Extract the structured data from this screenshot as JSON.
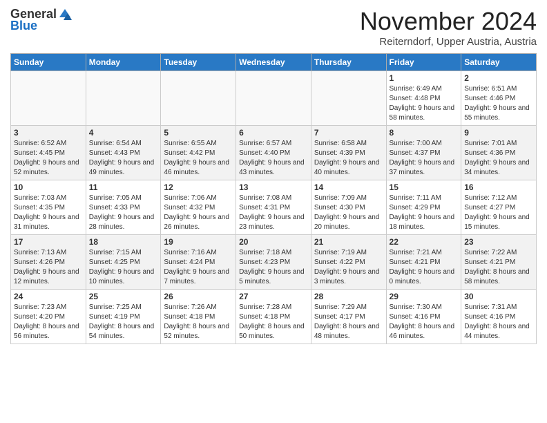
{
  "header": {
    "logo_general": "General",
    "logo_blue": "Blue",
    "month_title": "November 2024",
    "location": "Reiterndorf, Upper Austria, Austria"
  },
  "weekdays": [
    "Sunday",
    "Monday",
    "Tuesday",
    "Wednesday",
    "Thursday",
    "Friday",
    "Saturday"
  ],
  "weeks": [
    [
      {
        "day": "",
        "info": ""
      },
      {
        "day": "",
        "info": ""
      },
      {
        "day": "",
        "info": ""
      },
      {
        "day": "",
        "info": ""
      },
      {
        "day": "",
        "info": ""
      },
      {
        "day": "1",
        "info": "Sunrise: 6:49 AM\nSunset: 4:48 PM\nDaylight: 9 hours and 58 minutes."
      },
      {
        "day": "2",
        "info": "Sunrise: 6:51 AM\nSunset: 4:46 PM\nDaylight: 9 hours and 55 minutes."
      }
    ],
    [
      {
        "day": "3",
        "info": "Sunrise: 6:52 AM\nSunset: 4:45 PM\nDaylight: 9 hours and 52 minutes."
      },
      {
        "day": "4",
        "info": "Sunrise: 6:54 AM\nSunset: 4:43 PM\nDaylight: 9 hours and 49 minutes."
      },
      {
        "day": "5",
        "info": "Sunrise: 6:55 AM\nSunset: 4:42 PM\nDaylight: 9 hours and 46 minutes."
      },
      {
        "day": "6",
        "info": "Sunrise: 6:57 AM\nSunset: 4:40 PM\nDaylight: 9 hours and 43 minutes."
      },
      {
        "day": "7",
        "info": "Sunrise: 6:58 AM\nSunset: 4:39 PM\nDaylight: 9 hours and 40 minutes."
      },
      {
        "day": "8",
        "info": "Sunrise: 7:00 AM\nSunset: 4:37 PM\nDaylight: 9 hours and 37 minutes."
      },
      {
        "day": "9",
        "info": "Sunrise: 7:01 AM\nSunset: 4:36 PM\nDaylight: 9 hours and 34 minutes."
      }
    ],
    [
      {
        "day": "10",
        "info": "Sunrise: 7:03 AM\nSunset: 4:35 PM\nDaylight: 9 hours and 31 minutes."
      },
      {
        "day": "11",
        "info": "Sunrise: 7:05 AM\nSunset: 4:33 PM\nDaylight: 9 hours and 28 minutes."
      },
      {
        "day": "12",
        "info": "Sunrise: 7:06 AM\nSunset: 4:32 PM\nDaylight: 9 hours and 26 minutes."
      },
      {
        "day": "13",
        "info": "Sunrise: 7:08 AM\nSunset: 4:31 PM\nDaylight: 9 hours and 23 minutes."
      },
      {
        "day": "14",
        "info": "Sunrise: 7:09 AM\nSunset: 4:30 PM\nDaylight: 9 hours and 20 minutes."
      },
      {
        "day": "15",
        "info": "Sunrise: 7:11 AM\nSunset: 4:29 PM\nDaylight: 9 hours and 18 minutes."
      },
      {
        "day": "16",
        "info": "Sunrise: 7:12 AM\nSunset: 4:27 PM\nDaylight: 9 hours and 15 minutes."
      }
    ],
    [
      {
        "day": "17",
        "info": "Sunrise: 7:13 AM\nSunset: 4:26 PM\nDaylight: 9 hours and 12 minutes."
      },
      {
        "day": "18",
        "info": "Sunrise: 7:15 AM\nSunset: 4:25 PM\nDaylight: 9 hours and 10 minutes."
      },
      {
        "day": "19",
        "info": "Sunrise: 7:16 AM\nSunset: 4:24 PM\nDaylight: 9 hours and 7 minutes."
      },
      {
        "day": "20",
        "info": "Sunrise: 7:18 AM\nSunset: 4:23 PM\nDaylight: 9 hours and 5 minutes."
      },
      {
        "day": "21",
        "info": "Sunrise: 7:19 AM\nSunset: 4:22 PM\nDaylight: 9 hours and 3 minutes."
      },
      {
        "day": "22",
        "info": "Sunrise: 7:21 AM\nSunset: 4:21 PM\nDaylight: 9 hours and 0 minutes."
      },
      {
        "day": "23",
        "info": "Sunrise: 7:22 AM\nSunset: 4:21 PM\nDaylight: 8 hours and 58 minutes."
      }
    ],
    [
      {
        "day": "24",
        "info": "Sunrise: 7:23 AM\nSunset: 4:20 PM\nDaylight: 8 hours and 56 minutes."
      },
      {
        "day": "25",
        "info": "Sunrise: 7:25 AM\nSunset: 4:19 PM\nDaylight: 8 hours and 54 minutes."
      },
      {
        "day": "26",
        "info": "Sunrise: 7:26 AM\nSunset: 4:18 PM\nDaylight: 8 hours and 52 minutes."
      },
      {
        "day": "27",
        "info": "Sunrise: 7:28 AM\nSunset: 4:18 PM\nDaylight: 8 hours and 50 minutes."
      },
      {
        "day": "28",
        "info": "Sunrise: 7:29 AM\nSunset: 4:17 PM\nDaylight: 8 hours and 48 minutes."
      },
      {
        "day": "29",
        "info": "Sunrise: 7:30 AM\nSunset: 4:16 PM\nDaylight: 8 hours and 46 minutes."
      },
      {
        "day": "30",
        "info": "Sunrise: 7:31 AM\nSunset: 4:16 PM\nDaylight: 8 hours and 44 minutes."
      }
    ]
  ]
}
